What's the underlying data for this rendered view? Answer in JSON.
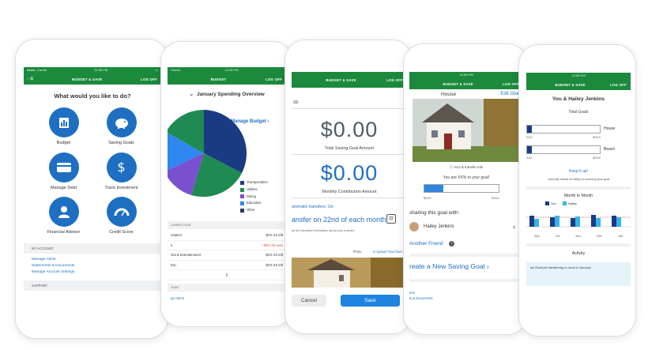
{
  "status": {
    "carrier": "●●●●○ Carrier",
    "time": "12:06 PM"
  },
  "brand": {
    "green": "#1b8a3c",
    "blue": "#1e6fc2"
  },
  "phone1": {
    "nav_title": "BUDGET & SAVE",
    "logoff": "LOG OFF",
    "title": "What would you like to do?",
    "features": [
      {
        "label": "Budget",
        "icon": "bar-chart-icon"
      },
      {
        "label": "Saving Goals",
        "icon": "piggy-bank-icon"
      },
      {
        "label": "Manage Debt",
        "icon": "credit-card-icon"
      },
      {
        "label": "Track Investment",
        "icon": "investment-icon"
      },
      {
        "label": "Financial Advisor",
        "icon": "advisor-icon"
      },
      {
        "label": "Credit Score",
        "icon": "gauge-icon"
      }
    ],
    "my_account": "MY ACCOUNT",
    "links": [
      "Manage Alerts",
      "Statements & Documents",
      "Manage Account Settings"
    ],
    "support": "SUPPORT"
  },
  "phone2": {
    "status_left": "Carrier",
    "time": "12:06 PM",
    "nav_title": "BUDGET",
    "logoff": "LOG OFF",
    "overview": "January Spending Overview",
    "manage_budget": "Manage Budget",
    "legend": [
      {
        "label": "Transportation",
        "color": "#1a3b84"
      },
      {
        "label": "Utilities",
        "color": "#1f8a52"
      },
      {
        "label": "Dining",
        "color": "#7a4fd0"
      },
      {
        "label": "Education",
        "color": "#2f87f0"
      },
      {
        "label": "Other",
        "color": "#2b3a66"
      }
    ],
    "section": "LOWER LOOK",
    "rows": [
      {
        "name": "ortation",
        "value": "$XX.XX left",
        "over": false
      },
      {
        "name": "s",
        "value": "! $XX.XX over",
        "over": true
      },
      {
        "name": "Out & Entertainment",
        "value": "$XX.XX left",
        "over": false
      },
      {
        "name": "tion",
        "value": "$XX.XX left",
        "over": false
      }
    ],
    "section2": "OUNT",
    "link": "ge Alerts"
  },
  "phone3": {
    "nav_title": "BUDGET & SAVE",
    "logoff": "LOG OFF",
    "top_text": "SE",
    "total": "$0.00",
    "total_caption": "Total Saving Goal Amount",
    "monthly": "$0.00",
    "monthly_caption": "Monthly Contribution Amount",
    "auto": "utomatic transfers: On",
    "transfer": "ansfer on 22nd of each month",
    "tip": "tip for important information about your transfer.",
    "photo": "Photo",
    "upload": "or Upload Your Own",
    "cancel": "Cancel",
    "save": "Save"
  },
  "phone4": {
    "nav_title": "BUDGET & SAVE",
    "logoff": "LOG OFF",
    "house": "House",
    "edit": "Edit Goal",
    "acct": "Acct & transfer info",
    "progress_text": "You are XX% to your goal!",
    "progress": 0.25,
    "left_val": "$XXX",
    "right_val": "$XXX",
    "sharing": "sharing this goal with:",
    "friend": "Hailey Jenkins",
    "add_friend": "Another Friend",
    "create": "reate a New Saving Goal",
    "links": [
      "ons",
      "ts & Documents"
    ]
  },
  "phone5": {
    "nav_title": "BUDGET & SAVE",
    "logoff": "LOG OFF",
    "title": "You & Hailey Jenkins",
    "total_goals": "Total Goals",
    "goals": [
      {
        "label": "House",
        "fill": 0.07,
        "left": "XXX",
        "right": "$XXX"
      },
      {
        "label": "Beach",
        "fill": 0.06,
        "left": "XXX",
        "right": "$XXX"
      }
    ],
    "keep_up": "Keep it up!",
    "ahead": "currently ahead of Hailey in reaching your goal",
    "m2m": "Month to Month",
    "legend_you": "You",
    "legend_hailey": "Hailey",
    "months": [
      "Sep",
      "Oct",
      "Nov",
      "Dec",
      "Jan"
    ],
    "activity": "Activity",
    "activity_text": "ey! Great job transferring xx much in January!"
  }
}
